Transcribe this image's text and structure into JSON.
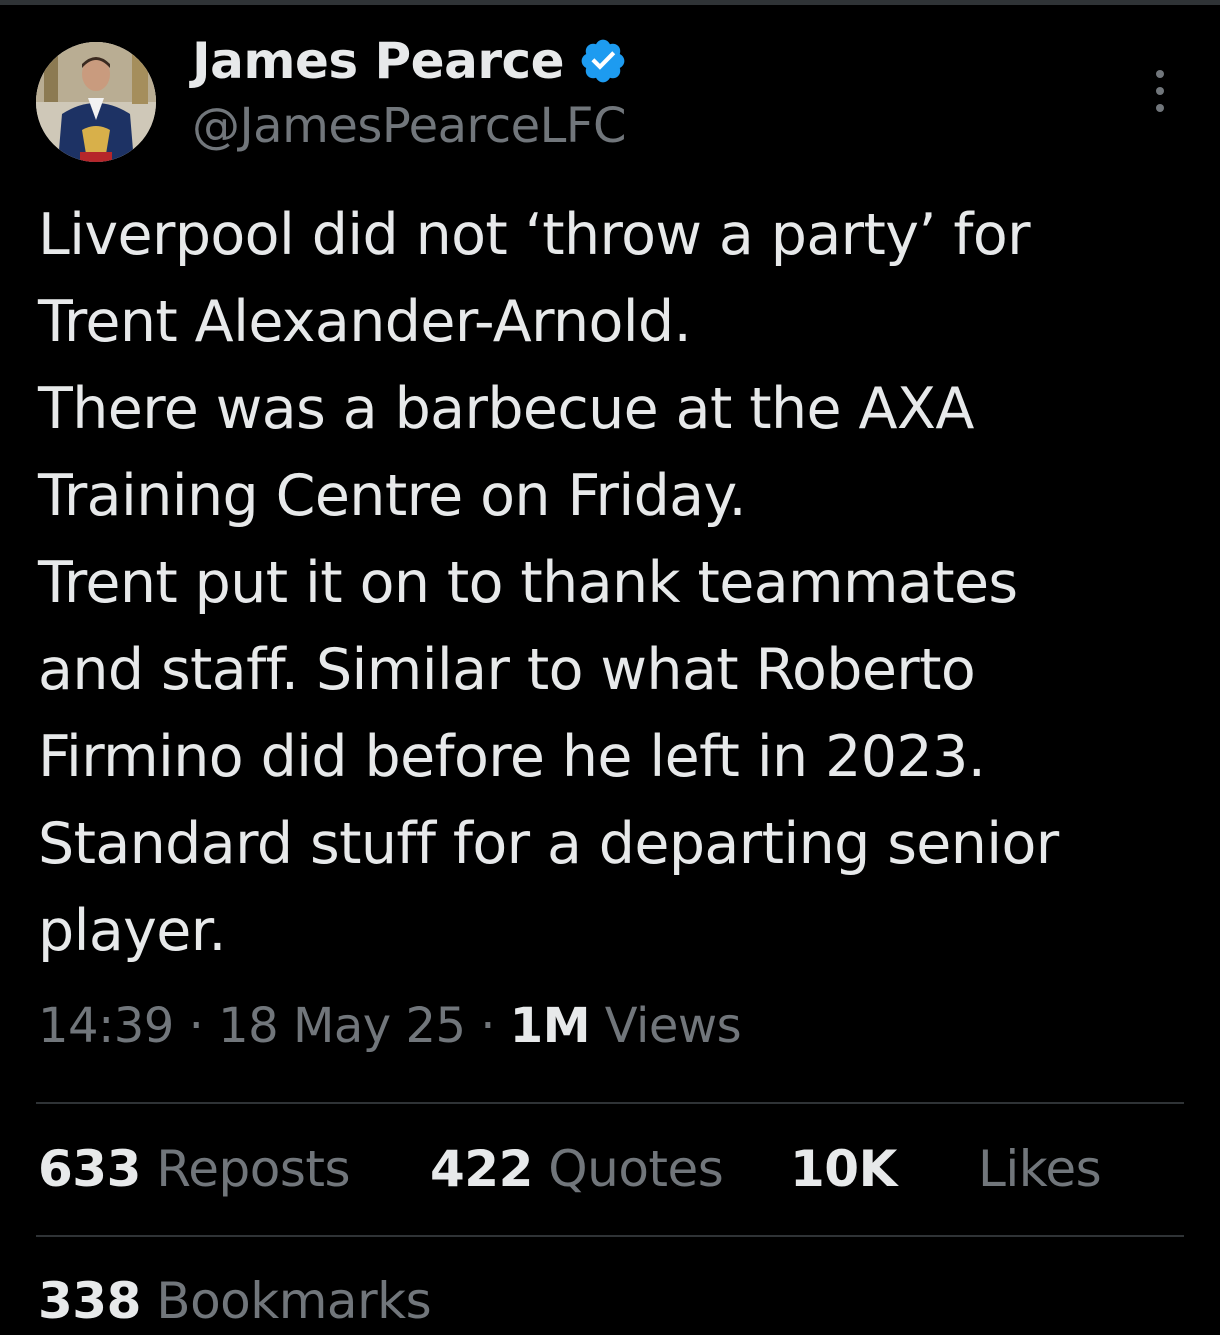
{
  "author": {
    "display_name": "James Pearce",
    "handle": "@JamesPearceLFC",
    "verified": true,
    "verified_color": "#1d9bf0",
    "avatar_icon": "profile-photo"
  },
  "menu": {
    "icon": "more-vertical-icon"
  },
  "tweet": {
    "lines": [
      "Liverpool did not ‘throw a party’ for",
      "Trent Alexander-Arnold.",
      "There was a barbecue at the AXA",
      "Training Centre on Friday.",
      "Trent put it on to thank teammates",
      "and staff. Similar to what Roberto",
      "Firmino did before he left in 2023.",
      "Standard stuff for a departing senior",
      "player."
    ]
  },
  "meta": {
    "time": "14:39",
    "separator": " · ",
    "date": "18 May 25",
    "views_count": "1M",
    "views_label": "Views"
  },
  "stats": {
    "reposts_count": "633",
    "reposts_label": "Reposts",
    "quotes_count": "422",
    "quotes_label": "Quotes",
    "likes_count": "10K",
    "likes_label": "Likes",
    "bookmarks_count": "338",
    "bookmarks_label": "Bookmarks"
  },
  "colors": {
    "background": "#000000",
    "text_primary": "#e7e9ea",
    "text_secondary": "#71767b",
    "divider": "#2f3336"
  }
}
